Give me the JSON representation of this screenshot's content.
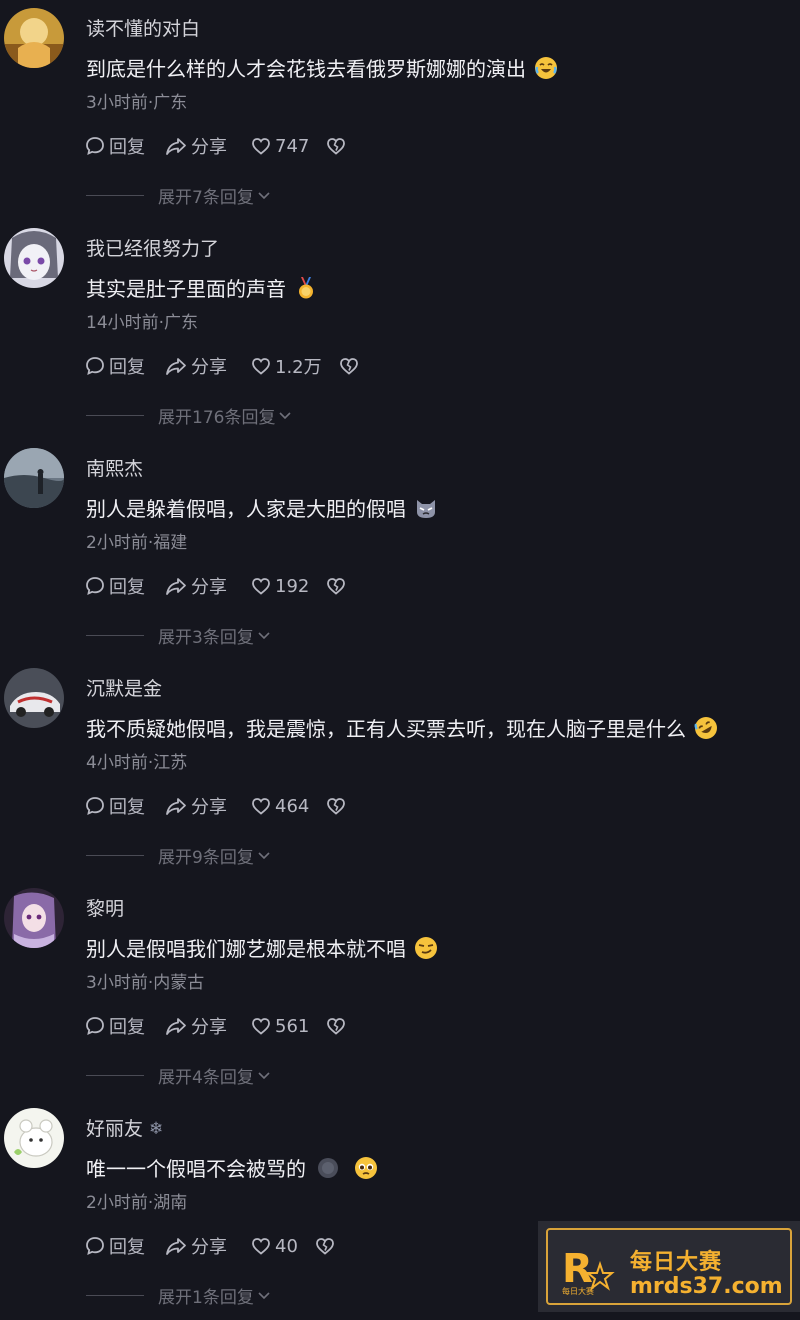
{
  "comments": [
    {
      "username": "读不懂的对白",
      "text": "到底是什么样的人才会花钱去看俄罗斯娜娜的演出",
      "emoji": "crying-laughing-emoji",
      "meta": "3小时前·广东",
      "reply_label": "回复",
      "share_label": "分享",
      "likes": "747",
      "expand": "展开7条回复"
    },
    {
      "username": "我已经很努力了",
      "text": "其实是肚子里面的声音",
      "emoji": "medal-emoji",
      "meta": "14小时前·广东",
      "reply_label": "回复",
      "share_label": "分享",
      "likes": "1.2万",
      "expand": "展开176条回复"
    },
    {
      "username": "南熙杰",
      "text": "别人是躲着假唱，人家是大胆的假唱",
      "emoji": "cat-emoji",
      "meta": "2小时前·福建",
      "reply_label": "回复",
      "share_label": "分享",
      "likes": "192",
      "expand": "展开3条回复"
    },
    {
      "username": "沉默是金",
      "text": "我不质疑她假唱，我是震惊，正有人买票去听，现在人脑子里是什么",
      "emoji": "rofl-emoji",
      "meta": "4小时前·江苏",
      "reply_label": "回复",
      "share_label": "分享",
      "likes": "464",
      "expand": "展开9条回复"
    },
    {
      "username": "黎明",
      "text": "别人是假唱我们娜艺娜是根本就不唱",
      "emoji": "smirk-emoji",
      "meta": "3小时前·内蒙古",
      "reply_label": "回复",
      "share_label": "分享",
      "likes": "561",
      "expand": "展开4条回复"
    },
    {
      "username": "好丽友",
      "badge": "snowflake-badge",
      "text": "唯一一个假唱不会被骂的",
      "emoji": "pleading-emoji",
      "extra_emoji": "dark-blob-emoji",
      "meta": "2小时前·湖南",
      "reply_label": "回复",
      "share_label": "分享",
      "likes": "40",
      "expand": "展开1条回复"
    }
  ],
  "watermark": {
    "title": "每日大赛",
    "url": "mrds37.com",
    "logo_letter": "R",
    "logo_small": "每日大赛"
  },
  "colors": {
    "background": "#15161e",
    "watermark_gold": "#f5b130"
  }
}
